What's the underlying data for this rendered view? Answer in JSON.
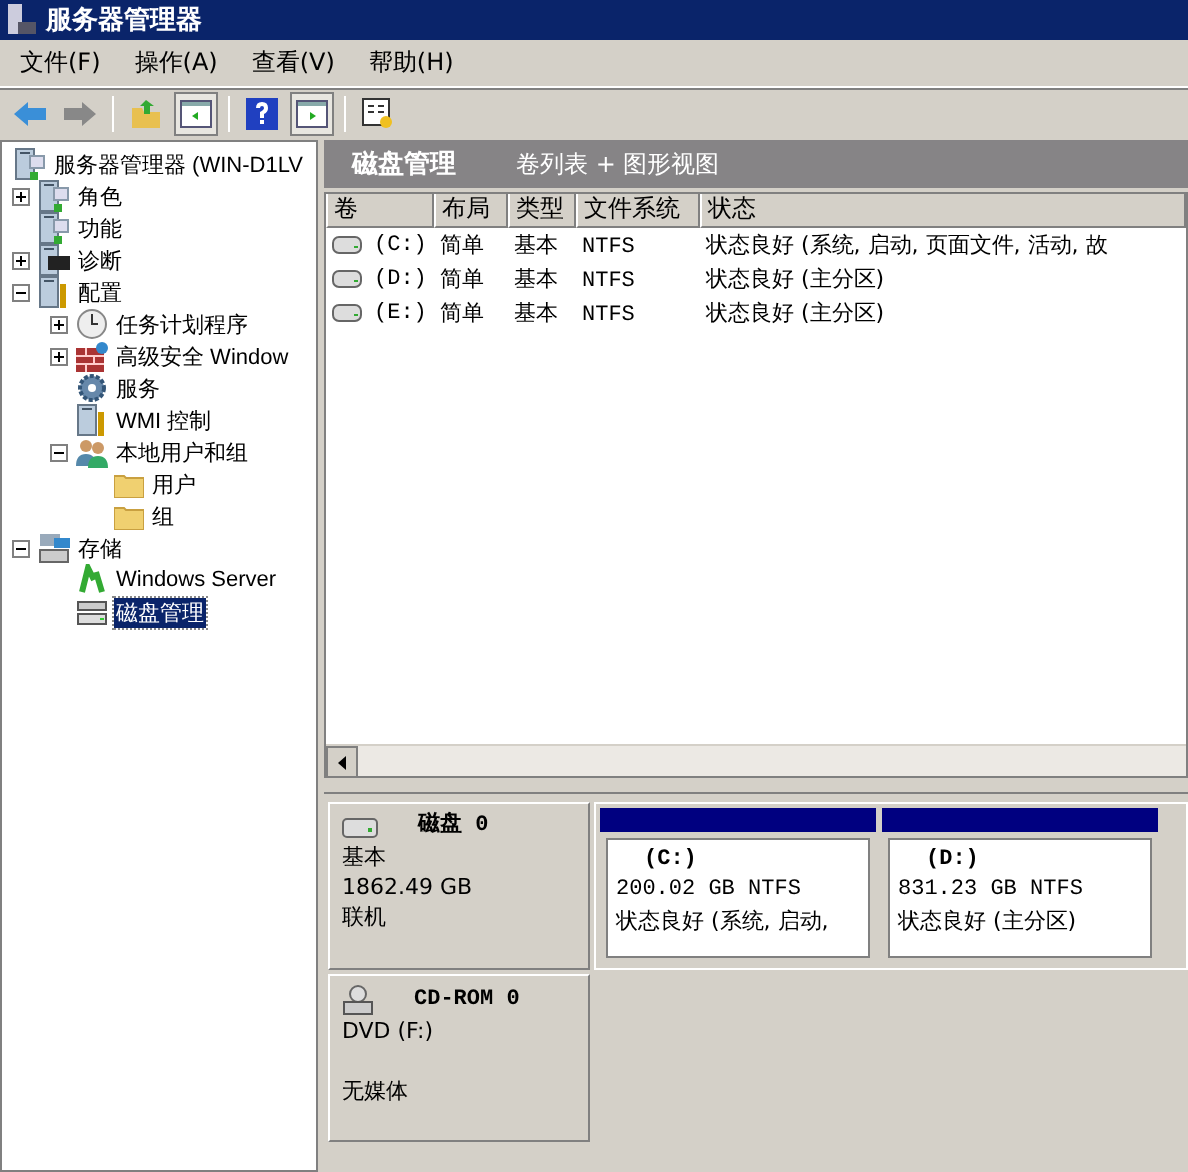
{
  "window": {
    "title": "服务器管理器"
  },
  "menu": [
    "文件(F)",
    "操作(A)",
    "查看(V)",
    "帮助(H)"
  ],
  "toolbar": [
    {
      "kind": "back",
      "pressed": false
    },
    {
      "kind": "forward",
      "pressed": false
    },
    {
      "kind": "sep"
    },
    {
      "kind": "up",
      "pressed": false
    },
    {
      "kind": "panel-left",
      "pressed": true
    },
    {
      "kind": "sep"
    },
    {
      "kind": "help",
      "pressed": false
    },
    {
      "kind": "panel-right",
      "pressed": true
    },
    {
      "kind": "sep"
    },
    {
      "kind": "properties",
      "pressed": false
    }
  ],
  "tree": [
    {
      "label": "服务器管理器 (WIN-D1LV",
      "selected": false,
      "children": [
        {
          "label": "角色",
          "expanded": false,
          "selected": false
        },
        {
          "label": "功能",
          "selected": false
        },
        {
          "label": "诊断",
          "expanded": false,
          "selected": false
        },
        {
          "label": "配置",
          "expanded": true,
          "selected": false,
          "children": [
            {
              "label": "任务计划程序",
              "expanded": false,
              "selected": false
            },
            {
              "label": "高级安全 Window",
              "expanded": false,
              "selected": false
            },
            {
              "label": "服务",
              "selected": false
            },
            {
              "label": "WMI 控制",
              "selected": false
            },
            {
              "label": "本地用户和组",
              "expanded": true,
              "selected": false,
              "children": [
                {
                  "label": "用户",
                  "selected": false
                },
                {
                  "label": "组",
                  "selected": false
                }
              ]
            }
          ]
        },
        {
          "label": "存储",
          "expanded": true,
          "selected": false,
          "children": [
            {
              "label": "Windows Server",
              "selected": false
            },
            {
              "label": "磁盘管理",
              "selected": true
            }
          ]
        }
      ]
    }
  ],
  "header": {
    "title": "磁盘管理",
    "view": "卷列表 + 图形视图"
  },
  "columns": [
    "卷",
    "布局",
    "类型",
    "文件系统",
    "状态"
  ],
  "volumes": [
    {
      "volume": "(C:)",
      "layout": "简单",
      "type": "基本",
      "fs": "NTFS",
      "status": "状态良好 (系统, 启动, 页面文件, 活动, 故"
    },
    {
      "volume": "(D:)",
      "layout": "简单",
      "type": "基本",
      "fs": "NTFS",
      "status": "状态良好 (主分区)"
    },
    {
      "volume": "(E:)",
      "layout": "简单",
      "type": "基本",
      "fs": "NTFS",
      "status": "状态良好 (主分区)"
    }
  ],
  "disks": [
    {
      "kind": "disk",
      "name": "磁盘 0",
      "lines": [
        "基本",
        "1862.49 GB",
        "联机"
      ],
      "partitions": [
        {
          "name": "(C:)",
          "size": "200.02 GB NTFS",
          "status": "状态良好 (系统, 启动,"
        },
        {
          "name": "(D:)",
          "size": "831.23 GB NTFS",
          "status": "状态良好 (主分区)"
        }
      ]
    },
    {
      "kind": "cdrom",
      "name": "CD-ROM 0",
      "lines": [
        "DVD (F:)",
        "无媒体"
      ]
    }
  ]
}
